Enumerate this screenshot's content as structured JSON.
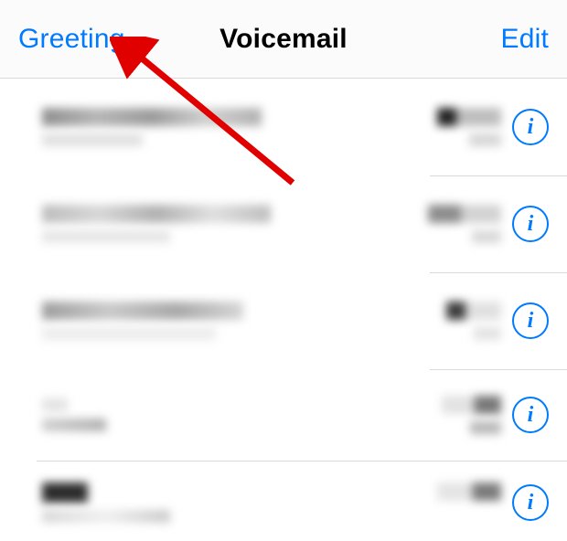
{
  "navbar": {
    "greeting_label": "Greeting",
    "title": "Voicemail",
    "edit_label": "Edit"
  },
  "info_icon_glyph": "i",
  "voicemails": [
    {
      "id": 0
    },
    {
      "id": 1
    },
    {
      "id": 2
    },
    {
      "id": 3
    },
    {
      "id": 4
    }
  ]
}
